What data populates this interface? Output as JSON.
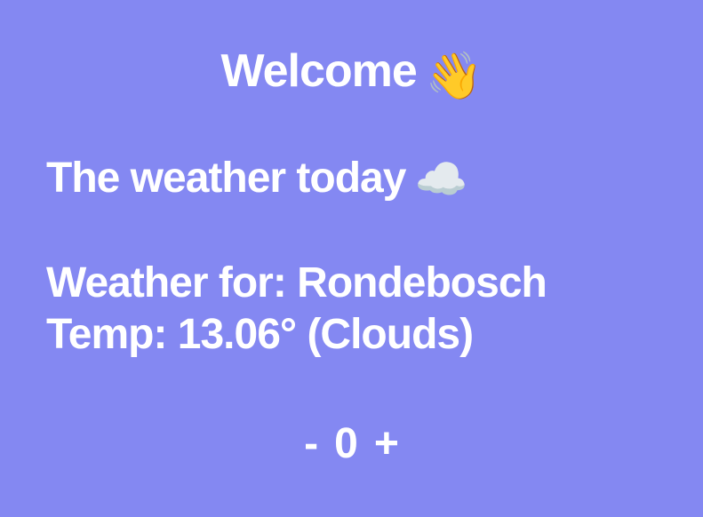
{
  "greeting": {
    "text": "Welcome",
    "emoji": "👋",
    "emoji_name": "waving-hand-icon"
  },
  "weather_heading": {
    "text": "The weather today",
    "emoji": "☁️",
    "emoji_name": "cloud-icon"
  },
  "weather": {
    "location_label": "Weather for:",
    "location": "Rondebosch",
    "temp_label": "Temp:",
    "temp": "13.06°",
    "condition": "(Clouds)"
  },
  "counter": {
    "decrement_label": "-",
    "value": "0",
    "increment_label": "+"
  },
  "colors": {
    "background": "#8488f2",
    "text": "#ffffff"
  }
}
